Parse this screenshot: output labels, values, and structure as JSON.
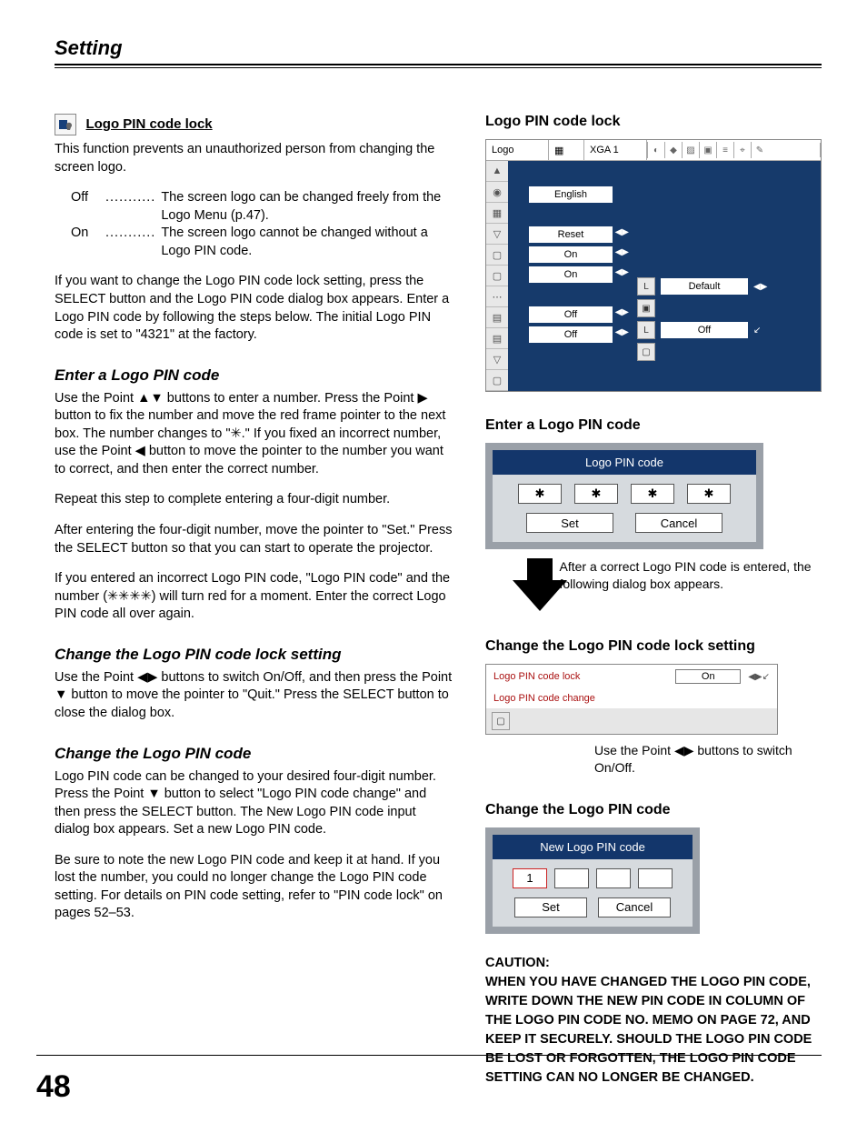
{
  "header": {
    "title": "Setting"
  },
  "page_number": "48",
  "left": {
    "feature_title": "Logo PIN code lock",
    "intro": "This function prevents an unauthorized person from changing the screen logo.",
    "options": [
      {
        "key": "Off",
        "dots": "...........",
        "val": "The screen logo can be changed freely from the Logo Menu (p.47)."
      },
      {
        "key": "On",
        "dots": "...........",
        "val": "The screen logo cannot be changed without a Logo PIN code."
      }
    ],
    "para1": "If you want to change the Logo PIN code lock setting, press the SELECT button and the Logo PIN code dialog box appears. Enter a Logo PIN code by following the steps below. The initial Logo PIN code is set to \"4321\" at the factory.",
    "h_enter": "Enter a Logo PIN code",
    "enter_p1": "Use the Point ▲▼ buttons to enter a number. Press the Point ▶ button to fix the number and move the red frame pointer to the next box. The number changes to \"✳.\" If you fixed an incorrect number, use the Point ◀ button to move the pointer to the number you want to correct, and then enter the correct number.",
    "enter_p2": "Repeat this step to complete entering a four-digit number.",
    "enter_p3": "After entering the four-digit number, move the pointer to \"Set.\" Press the SELECT button so that you can start to operate the projector.",
    "enter_p4": "If you entered an incorrect Logo PIN code, \"Logo PIN code\" and the number (✳✳✳✳) will turn red for a moment. Enter the correct Logo PIN code all over again.",
    "h_change_setting": "Change the Logo PIN code lock setting",
    "change_setting_p": "Use the Point ◀▶ buttons to switch On/Off, and then press the Point ▼ button to move the pointer to \"Quit.\" Press the SELECT button to close the dialog box.",
    "h_change_code": "Change the Logo PIN code",
    "change_code_p1": "Logo PIN code can be changed to your desired four-digit number. Press the Point ▼ button to select \"Logo PIN code change\" and then press the SELECT button. The New Logo PIN code input dialog box appears. Set a new Logo PIN code.",
    "change_code_p2": "Be sure to note the new Logo PIN code and keep it at hand. If you lost the number, you could no longer change the Logo PIN code setting. For details on PIN code setting, refer to \"PIN code lock\" on pages 52–53."
  },
  "right": {
    "h1": "Logo PIN code lock",
    "menu": {
      "logo_label": "Logo",
      "src_label": "XGA 1",
      "rows": [
        "English",
        "Reset",
        "On",
        "On",
        "Off",
        "Off"
      ],
      "default_label": "Default",
      "off_label": "Off"
    },
    "h2": "Enter a Logo PIN code",
    "pin_dialog": {
      "title": "Logo PIN code",
      "cells": [
        "✱",
        "✱",
        "✱",
        "✱"
      ],
      "set": "Set",
      "cancel": "Cancel"
    },
    "after_note": "After a correct Logo PIN code is entered, the following dialog box appears.",
    "h3": "Change the Logo PIN code lock setting",
    "lock_dialog": {
      "row1_label": "Logo PIN code lock",
      "row1_val": "On",
      "row2_label": "Logo PIN code change"
    },
    "note": "Use the Point ◀▶ buttons to switch On/Off.",
    "h4": "Change the Logo PIN code",
    "new_pin": {
      "title": "New Logo PIN code",
      "first": "1",
      "set": "Set",
      "cancel": "Cancel"
    },
    "caution_label": "CAUTION:",
    "caution": "WHEN YOU HAVE CHANGED THE LOGO PIN CODE, WRITE DOWN THE NEW PIN CODE IN COLUMN OF THE LOGO PIN CODE NO. MEMO ON PAGE 72, AND KEEP IT SECURELY. SHOULD THE LOGO PIN CODE BE LOST OR FORGOTTEN, THE LOGO PIN CODE SETTING CAN NO LONGER BE CHANGED."
  }
}
